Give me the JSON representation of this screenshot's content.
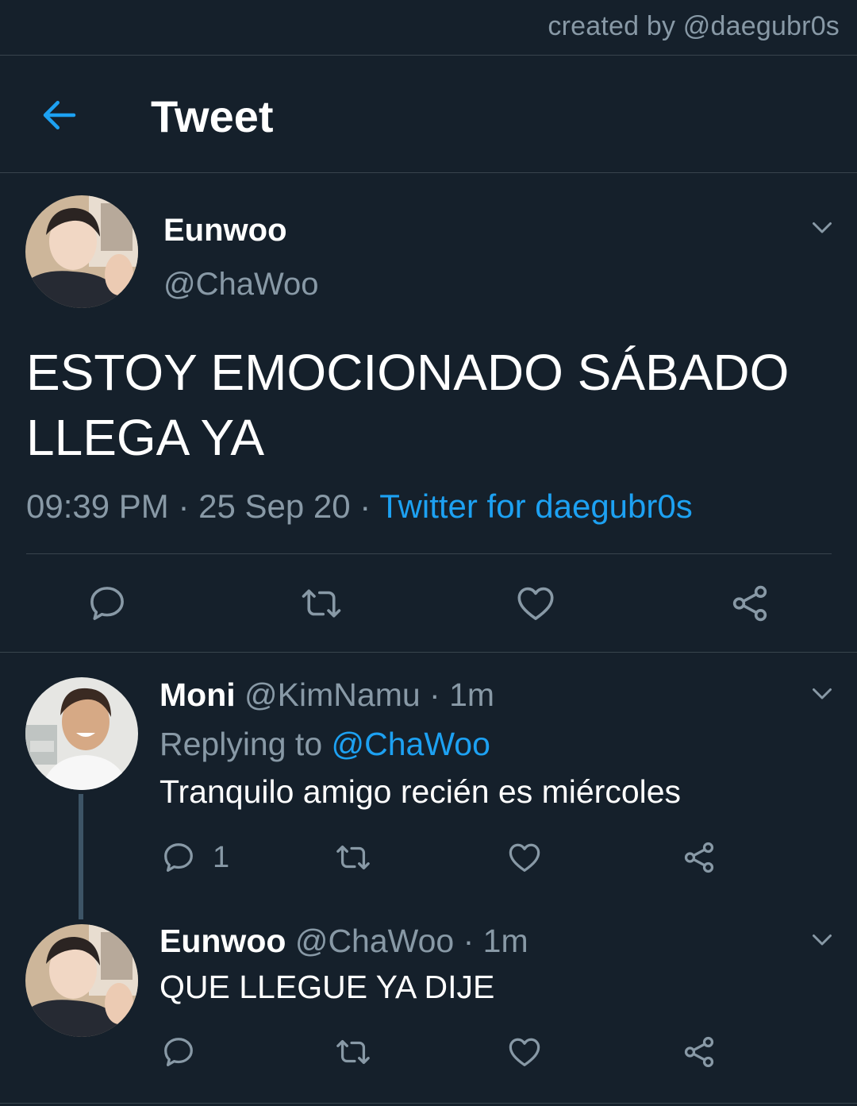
{
  "credit": "created by @daegubr0s",
  "header": {
    "back_icon": "arrow-left-icon",
    "title": "Tweet"
  },
  "main_tweet": {
    "name": "Eunwoo",
    "handle": "@ChaWoo",
    "text": "ESTOY EMOCIONADO SÁBADO LLEGA YA",
    "time": "09:39 PM",
    "date": "25 Sep 20",
    "source": "Twitter for daegubr0s",
    "separator": " · "
  },
  "replies": [
    {
      "name": "Moni",
      "handle": "@KimNamu",
      "time": "1m",
      "replying_prefix": "Replying to ",
      "replying_to": "@ChaWoo",
      "text": "Tranquilo amigo recién es miércoles",
      "reply_count": "1"
    },
    {
      "name": "Eunwoo",
      "handle": "@ChaWoo",
      "time": "1m",
      "text": "QUE LLEGUE YA DIJE"
    }
  ],
  "colors": {
    "background": "#15202b",
    "accent": "#1da1f2",
    "secondary_text": "#8899a6",
    "divider": "#38444d"
  }
}
